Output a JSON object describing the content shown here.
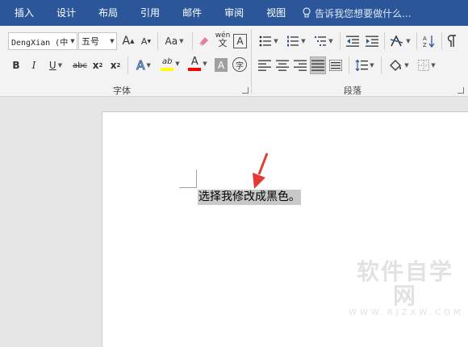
{
  "tabs": [
    "插入",
    "设计",
    "布局",
    "引用",
    "邮件",
    "审阅",
    "视图"
  ],
  "tell_me": "告诉我您想要做什么...",
  "font": {
    "name": "DengXian (中",
    "size": "五号",
    "grow_label": "A",
    "shrink_label": "A",
    "case_label": "Aa",
    "phonetic_label": "wén",
    "border_label": "A",
    "bold": "B",
    "italic": "I",
    "underline": "U",
    "strike": "abc",
    "subscript": "x",
    "superscript": "x",
    "effects_label": "A",
    "highlight_label": "ab",
    "color_label": "A",
    "shading_label": "A",
    "enclose_label": "字"
  },
  "groups": {
    "font": "字体",
    "paragraph": "段落"
  },
  "document": {
    "selected_text": "选择我修改成黑色。"
  },
  "watermark": {
    "main": "软件自学网",
    "sub": "WWW.RJZXW.COM"
  },
  "colors": {
    "ribbon_tab_bg": "#2b579a",
    "highlight_yellow": "#ffff00",
    "font_red": "#ff0000",
    "arrow_red": "#e53935",
    "selection": "#c8c8c8"
  }
}
